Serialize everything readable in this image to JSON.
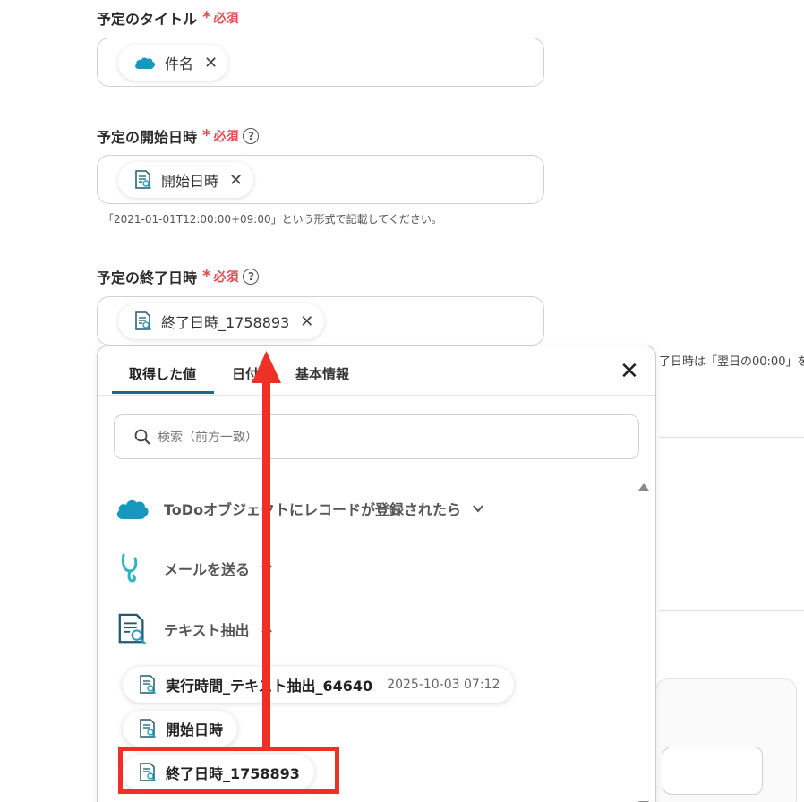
{
  "fields": {
    "title": {
      "label": "予定のタイトル",
      "required": "必須",
      "chip": "件名"
    },
    "start": {
      "label": "予定の開始日時",
      "required": "必須",
      "chip": "開始日時",
      "hint": "「2021-01-01T12:00:00+09:00」という形式で記載してください。"
    },
    "end": {
      "label": "予定の終了日時",
      "required": "必須",
      "chip": "終了日時_1758893",
      "hint_right": "了日時は「翌日の00:00」を"
    }
  },
  "help_glyph": "?",
  "chip_close": "✕",
  "panel": {
    "tabs": [
      {
        "label": "取得した値",
        "active": true
      },
      {
        "label": "日付"
      },
      {
        "label": "基本情報"
      }
    ],
    "close": "✕",
    "search_placeholder": "検索（前方一致）",
    "groups": [
      {
        "label": "ToDoオブジェクトにレコードが登録されたら",
        "icon": "salesforce-cloud-icon",
        "expanded": false
      },
      {
        "label": "メールを送る",
        "icon": "yoom-mail-icon",
        "expanded": false
      },
      {
        "label": "テキスト抽出",
        "icon": "text-extract-icon",
        "expanded": true
      }
    ],
    "items": [
      {
        "label": "実行時間_テキスト抽出_64640",
        "meta": "2025-10-03 07:12"
      },
      {
        "label": "開始日時",
        "meta": ""
      },
      {
        "label": "終了日時_1758893",
        "meta": ""
      }
    ]
  },
  "colors": {
    "required": "#e5484d",
    "tab_active": "#1e6a8a",
    "annotation": "#ee3124",
    "salesforce": "#1798c1"
  }
}
